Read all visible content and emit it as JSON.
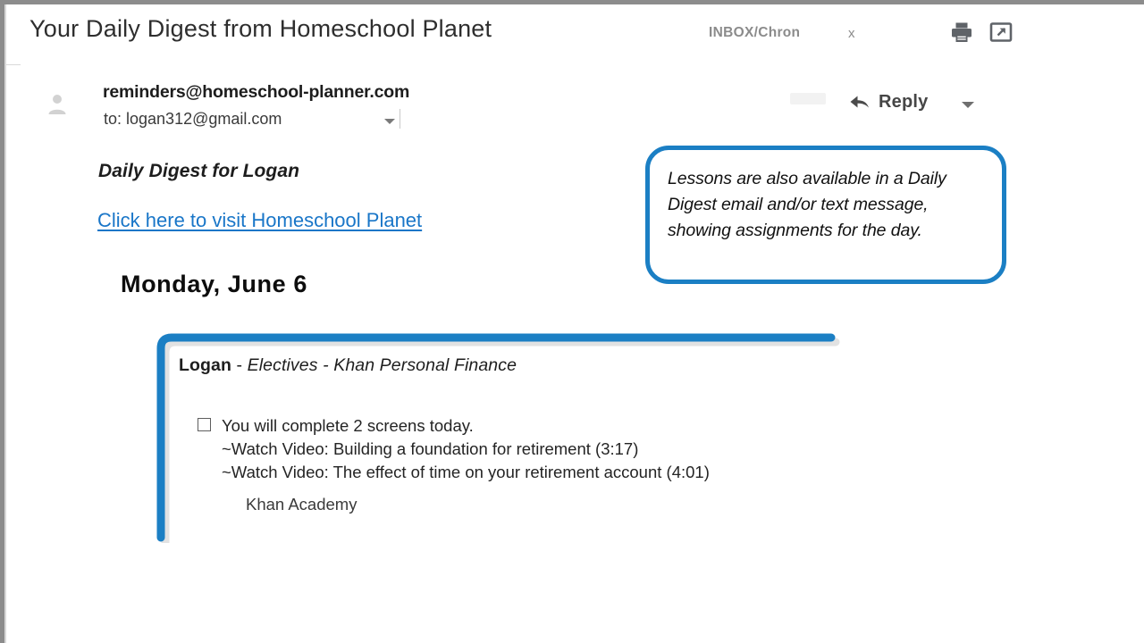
{
  "window": {
    "frame_color": "#8c8c8c"
  },
  "email_header": {
    "subject": "Your Daily Digest from Homeschool Planet",
    "label": "INBOX/Chron",
    "label_close": "x",
    "print_icon": "printer-icon",
    "popout_icon": "open-in-new-window-icon"
  },
  "sender_block": {
    "avatar_icon": "contact-avatar-icon",
    "from": "reminders@homeschool-planner.com",
    "to": "to: logan312@gmail.com",
    "details_caret_icon": "chevron-down-icon",
    "reply_label": "Reply",
    "reply_icon": "reply-arrow-icon",
    "more_caret_icon": "chevron-down-icon"
  },
  "body": {
    "digest_title": "Daily Digest for Logan",
    "visit_link": "Click here to visit Homeschool Planet",
    "day_heading": "Monday, June 6"
  },
  "callout": {
    "text": "Lessons are also available in a Daily Digest email and/or text message, showing assignments for the day.",
    "border_color": "#1b7fc4"
  },
  "lesson": {
    "bracket_color": "#1b7fc4",
    "student": "Logan",
    "separator_one": " - ",
    "subject": "Electives",
    "separator_two": " - ",
    "course": "Khan Personal Finance",
    "heading_full": "Logan - Electives - Khan Personal Finance",
    "checkbox_checked": false,
    "task_main": "You will complete 2 screens today.",
    "task_items": [
      "~Watch Video: Building a foundation for retirement (3:17)",
      "~Watch Video: The effect of time on your retirement account (4:01)"
    ],
    "source": "Khan Academy"
  },
  "colors": {
    "link": "#1976c8",
    "accent_blue": "#1b7fc4",
    "text": "#1d1d1d",
    "muted": "#8b8b8b"
  }
}
